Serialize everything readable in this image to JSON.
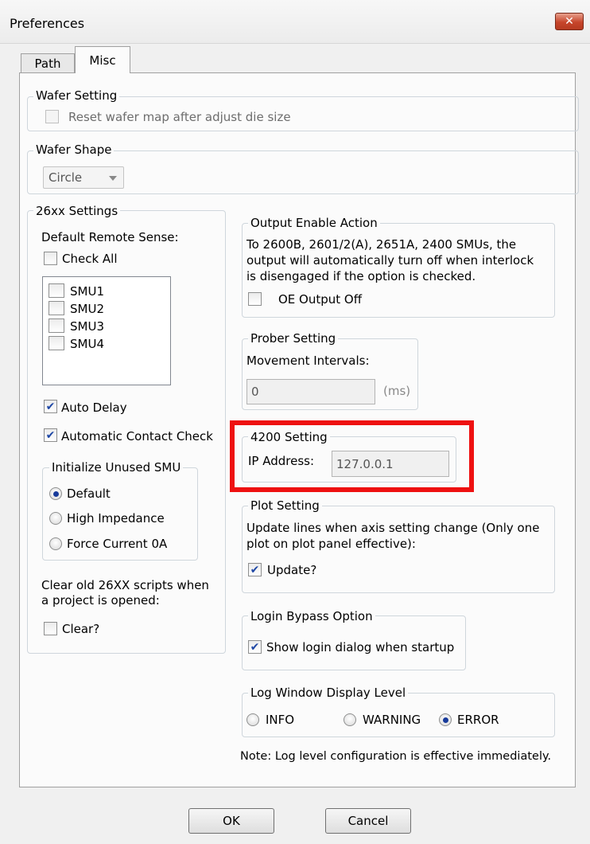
{
  "window": {
    "title": "Preferences",
    "close_glyph": "✕"
  },
  "tabs": [
    {
      "label": "Path"
    },
    {
      "label": "Misc"
    }
  ],
  "wafer_setting": {
    "legend": "Wafer Setting",
    "reset_label": "Reset wafer map after adjust die size",
    "reset_checked": false
  },
  "wafer_shape": {
    "legend": "Wafer Shape",
    "value": "Circle"
  },
  "settings_26xx": {
    "legend": "26xx Settings",
    "remote_sense_label": "Default Remote Sense:",
    "check_all_label": "Check All",
    "smus": [
      "SMU1",
      "SMU2",
      "SMU3",
      "SMU4"
    ],
    "auto_delay_label": "Auto Delay",
    "auto_contact_label": "Automatic Contact Check",
    "unused_smu": {
      "legend": "Initialize Unused SMU",
      "options": [
        "Default",
        "High Impedance",
        "Force Current 0A"
      ],
      "selected": "Default"
    },
    "clear_scripts_text": [
      "Clear old 26XX scripts when",
      "a project is opened:"
    ],
    "clear_label": "Clear?"
  },
  "output_enable": {
    "legend": "Output Enable Action",
    "description": [
      "To 2600B, 2601/2(A), 2651A, 2400 SMUs, the",
      "output will automatically turn off when interlock",
      "is disengaged if the option is checked."
    ],
    "oe_label": "OE Output Off"
  },
  "prober_setting": {
    "legend": "Prober Setting",
    "intervals_label": "Movement Intervals:",
    "intervals_value": "0",
    "unit": "(ms)"
  },
  "setting_4200": {
    "legend": "4200 Setting",
    "ip_label": "IP Address:",
    "ip_value": "127.0.0.1",
    "highlight_color": "#ee1111"
  },
  "plot_setting": {
    "legend": "Plot Setting",
    "description": [
      "Update lines when axis setting change (Only one",
      "plot on plot panel effective):"
    ],
    "update_label": "Update?"
  },
  "login_bypass": {
    "legend": "Login Bypass Option",
    "show_login_label": "Show login dialog when startup"
  },
  "log_window": {
    "legend": "Log Window Display Level",
    "options": [
      "INFO",
      "WARNING",
      "ERROR"
    ],
    "selected": "ERROR"
  },
  "note": "Note: Log level configuration is effective immediately.",
  "buttons": {
    "ok": "OK",
    "cancel": "Cancel"
  }
}
